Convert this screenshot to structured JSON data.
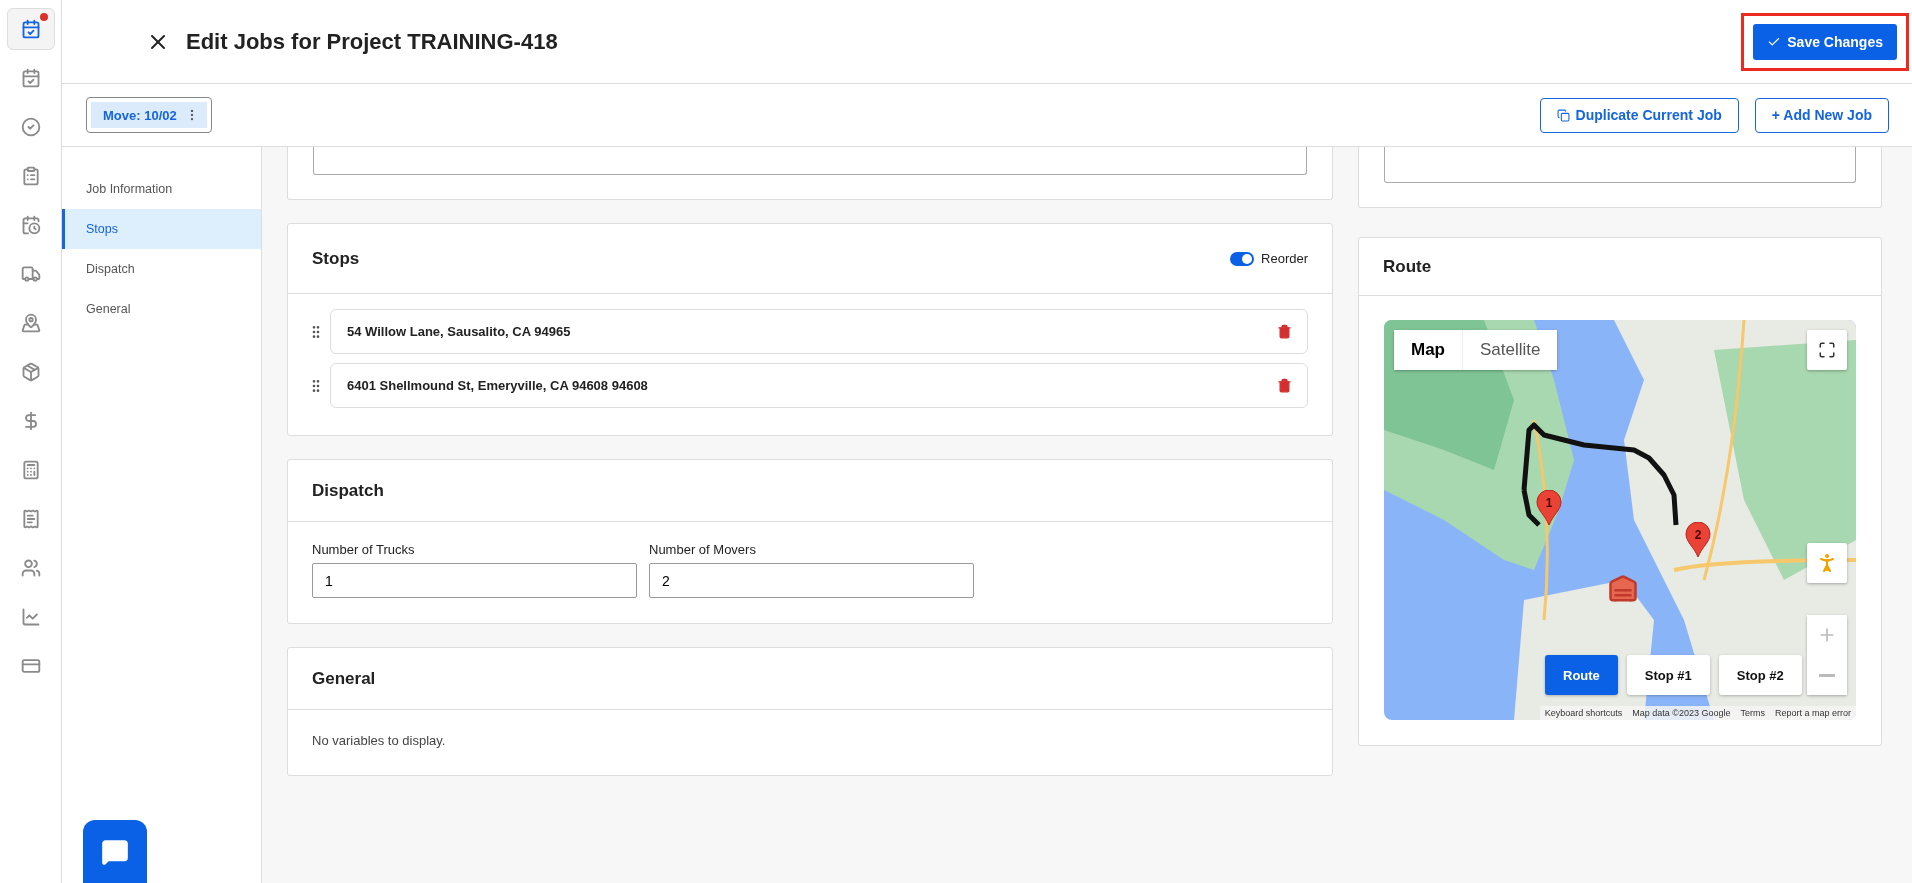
{
  "app_nav": [
    {
      "selected": true,
      "alert": true
    },
    {
      "selected": false,
      "alert": false
    },
    {
      "selected": false,
      "alert": false
    },
    {
      "selected": false,
      "alert": false
    },
    {
      "selected": false,
      "alert": false
    },
    {
      "selected": false,
      "alert": false
    },
    {
      "selected": false,
      "alert": false
    },
    {
      "selected": false,
      "alert": false
    },
    {
      "selected": false,
      "alert": false
    },
    {
      "selected": false,
      "alert": false
    },
    {
      "selected": false,
      "alert": false
    },
    {
      "selected": false,
      "alert": false
    },
    {
      "selected": false,
      "alert": false
    },
    {
      "selected": false,
      "alert": false
    }
  ],
  "header": {
    "title": "Edit Jobs for Project TRAINING-418",
    "save_button": "Save Changes",
    "highlighted": true
  },
  "toolbar": {
    "job_tab": {
      "label": "Move: 10/02",
      "selected": true
    },
    "buttons": [
      {
        "kind": "duplicate",
        "label": "Duplicate Current Job"
      },
      {
        "kind": "add",
        "label": "+ Add New Job"
      }
    ]
  },
  "section_nav": [
    {
      "label": "Job Information",
      "selected": false
    },
    {
      "label": "Stops",
      "selected": true
    },
    {
      "label": "Dispatch",
      "selected": false
    },
    {
      "label": "General",
      "selected": false
    }
  ],
  "stops": {
    "title": "Stops",
    "reorder": {
      "label": "Reorder",
      "on": true
    },
    "items": [
      {
        "address": "54 Willow Lane, Sausalito, CA 94965"
      },
      {
        "address": "6401 Shellmound St, Emeryville, CA 94608 94608"
      }
    ]
  },
  "dispatch": {
    "title": "Dispatch",
    "fields": [
      {
        "label": "Number of Trucks",
        "value": "1"
      },
      {
        "label": "Number of Movers",
        "value": "2"
      }
    ]
  },
  "general": {
    "title": "General",
    "message": "No variables to display."
  },
  "route": {
    "title": "Route",
    "map": {
      "kind": "picture",
      "map_types": [
        {
          "label": "Map",
          "selected": true
        },
        {
          "label": "Satellite",
          "selected": false
        }
      ],
      "markers": [
        {
          "label": "1"
        },
        {
          "label": "2"
        }
      ],
      "view_buttons": [
        {
          "label": "Route",
          "selected": true
        },
        {
          "label": "Stop #1",
          "selected": false
        },
        {
          "label": "Stop #2",
          "selected": false
        }
      ],
      "attribution": [
        "Keyboard shortcuts",
        "Map data ©2023 Google",
        "Terms",
        "Report a map error"
      ]
    }
  },
  "chat_button": {
    "kind": "chat"
  }
}
